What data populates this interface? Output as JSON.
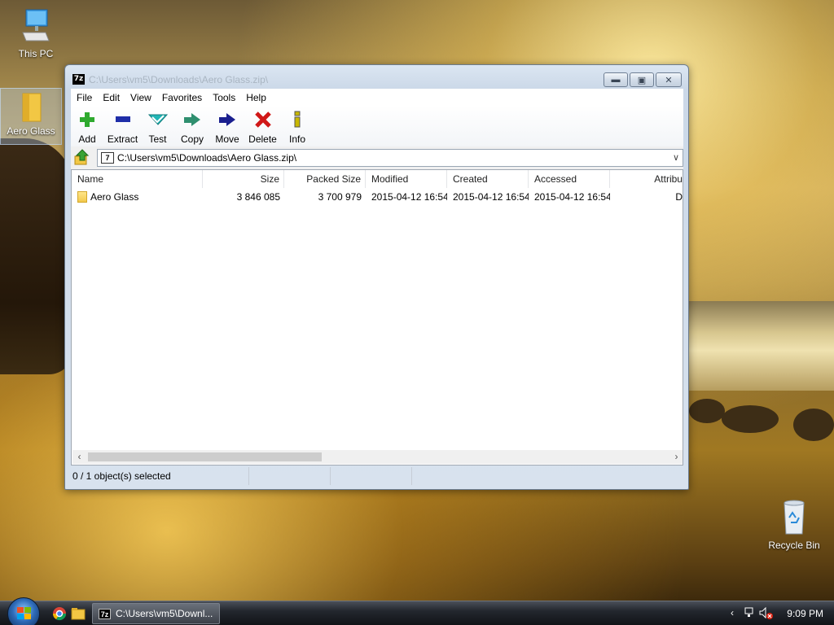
{
  "desktop": {
    "icons": [
      {
        "label": "This PC"
      },
      {
        "label": "Aero Glass"
      },
      {
        "label": "Recycle Bin"
      }
    ]
  },
  "window": {
    "title": "C:\\Users\\vm5\\Downloads\\Aero Glass.zip\\",
    "app_badge": "7z",
    "menu": [
      "File",
      "Edit",
      "View",
      "Favorites",
      "Tools",
      "Help"
    ],
    "toolbar": [
      {
        "label": "Add",
        "icon": "plus-icon",
        "color": "#2faa2f"
      },
      {
        "label": "Extract",
        "icon": "minus-icon",
        "color": "#1f2ea8"
      },
      {
        "label": "Test",
        "icon": "check-icon",
        "color": "#22b5b5"
      },
      {
        "label": "Copy",
        "icon": "copy-arrow-icon",
        "color": "#2f8f6f"
      },
      {
        "label": "Move",
        "icon": "move-arrow-icon",
        "color": "#1a1f8f"
      },
      {
        "label": "Delete",
        "icon": "delete-x-icon",
        "color": "#d01818"
      },
      {
        "label": "Info",
        "icon": "info-icon",
        "color": "#c9b800"
      }
    ],
    "address": {
      "value": "C:\\Users\\vm5\\Downloads\\Aero Glass.zip\\"
    },
    "columns": [
      "Name",
      "Size",
      "Packed Size",
      "Modified",
      "Created",
      "Accessed",
      "Attribute"
    ],
    "rows": [
      {
        "name": "Aero Glass",
        "size": "3 846 085",
        "packed_size": "3 700 979",
        "modified": "2015-04-12 16:54",
        "created": "2015-04-12 16:54",
        "accessed": "2015-04-12 16:54",
        "attributes": "D"
      }
    ],
    "status": [
      "0 / 1 object(s) selected",
      "",
      "",
      ""
    ]
  },
  "taskbar": {
    "task_title": "C:\\Users\\vm5\\Downl...",
    "task_badge": "7z",
    "clock": "9:09 PM"
  }
}
